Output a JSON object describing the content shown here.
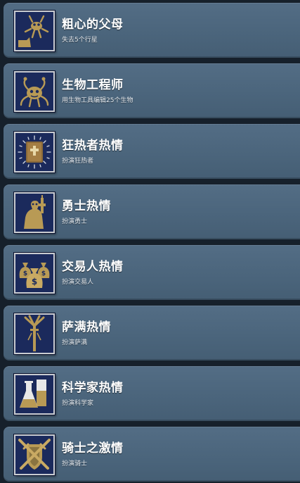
{
  "achievements": [
    {
      "title": "粗心的父母",
      "description": "失去5个行星",
      "icon": "falling-creature-icon"
    },
    {
      "title": "生物工程师",
      "description": "用生物工具编辑25个生物",
      "icon": "creature-editor-icon"
    },
    {
      "title": "狂热者热情",
      "description": "扮演狂热者",
      "icon": "holy-book-icon"
    },
    {
      "title": "勇士热情",
      "description": "扮演勇士",
      "icon": "warrior-with-gun-icon"
    },
    {
      "title": "交易人热情",
      "description": "扮演交易人",
      "icon": "money-bags-icon"
    },
    {
      "title": "萨满热情",
      "description": "扮演萨满",
      "icon": "shaman-staff-icon"
    },
    {
      "title": "科学家热情",
      "description": "扮演科学家",
      "icon": "lab-flask-icon"
    },
    {
      "title": "骑士之激情",
      "description": "扮演骑士",
      "icon": "crossed-swords-shield-icon"
    }
  ],
  "colors": {
    "card": "#4e687f",
    "icon_background": "#1b2a5c",
    "icon_art": "#b89a55",
    "icon_border": "#c9ccd1",
    "text": "#ffffff"
  }
}
